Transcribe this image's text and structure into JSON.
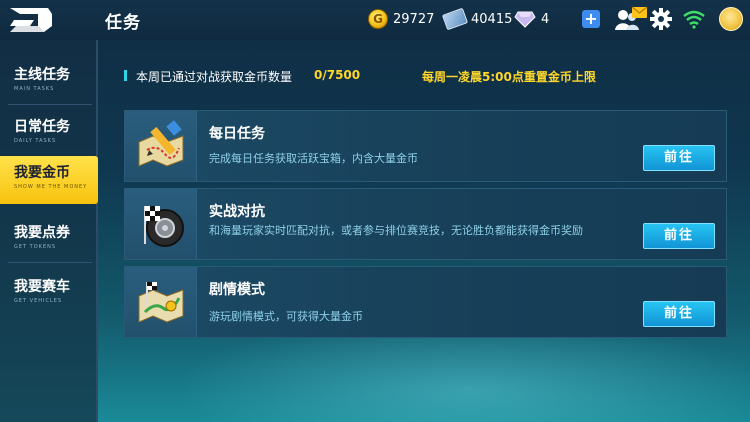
{
  "header": {
    "title": "任务",
    "coins": "29727",
    "tickets": "40415",
    "gems": "4",
    "coin_glyph": "G"
  },
  "sidebar": {
    "items": [
      {
        "label": "主线任务",
        "sub": "MAIN TASKS",
        "active": false
      },
      {
        "label": "日常任务",
        "sub": "DAILY TASKS",
        "active": false
      },
      {
        "label": "我要金币",
        "sub": "SHOW ME THE MONEY",
        "active": true
      },
      {
        "label": "我要点券",
        "sub": "GET TOKENS",
        "active": false
      },
      {
        "label": "我要赛车",
        "sub": "GET VEHICLES",
        "active": false
      }
    ]
  },
  "info": {
    "weekly_label": "本周已通过对战获取金币数量",
    "weekly_count": "0/7500",
    "reset_note": "每周一凌晨5:00点重置金币上限"
  },
  "tasks": [
    {
      "title": "每日任务",
      "desc": "完成每日任务获取活跃宝箱，内含大量金币",
      "button": "前往",
      "icon": "map-pencil-icon"
    },
    {
      "title": "实战对抗",
      "desc": "和海量玩家实时匹配对抗，或者参与排位赛竞技，无论胜负都能获得金币奖励",
      "button": "前往",
      "icon": "tire-flag-icon"
    },
    {
      "title": "剧情模式",
      "desc": "游玩剧情模式，可获得大量金币",
      "button": "前往",
      "icon": "story-map-icon"
    }
  ],
  "colors": {
    "accent_yellow": "#ffd62a",
    "button_blue": "#1ba7e6",
    "desc_cyan": "#8ed0e8"
  }
}
